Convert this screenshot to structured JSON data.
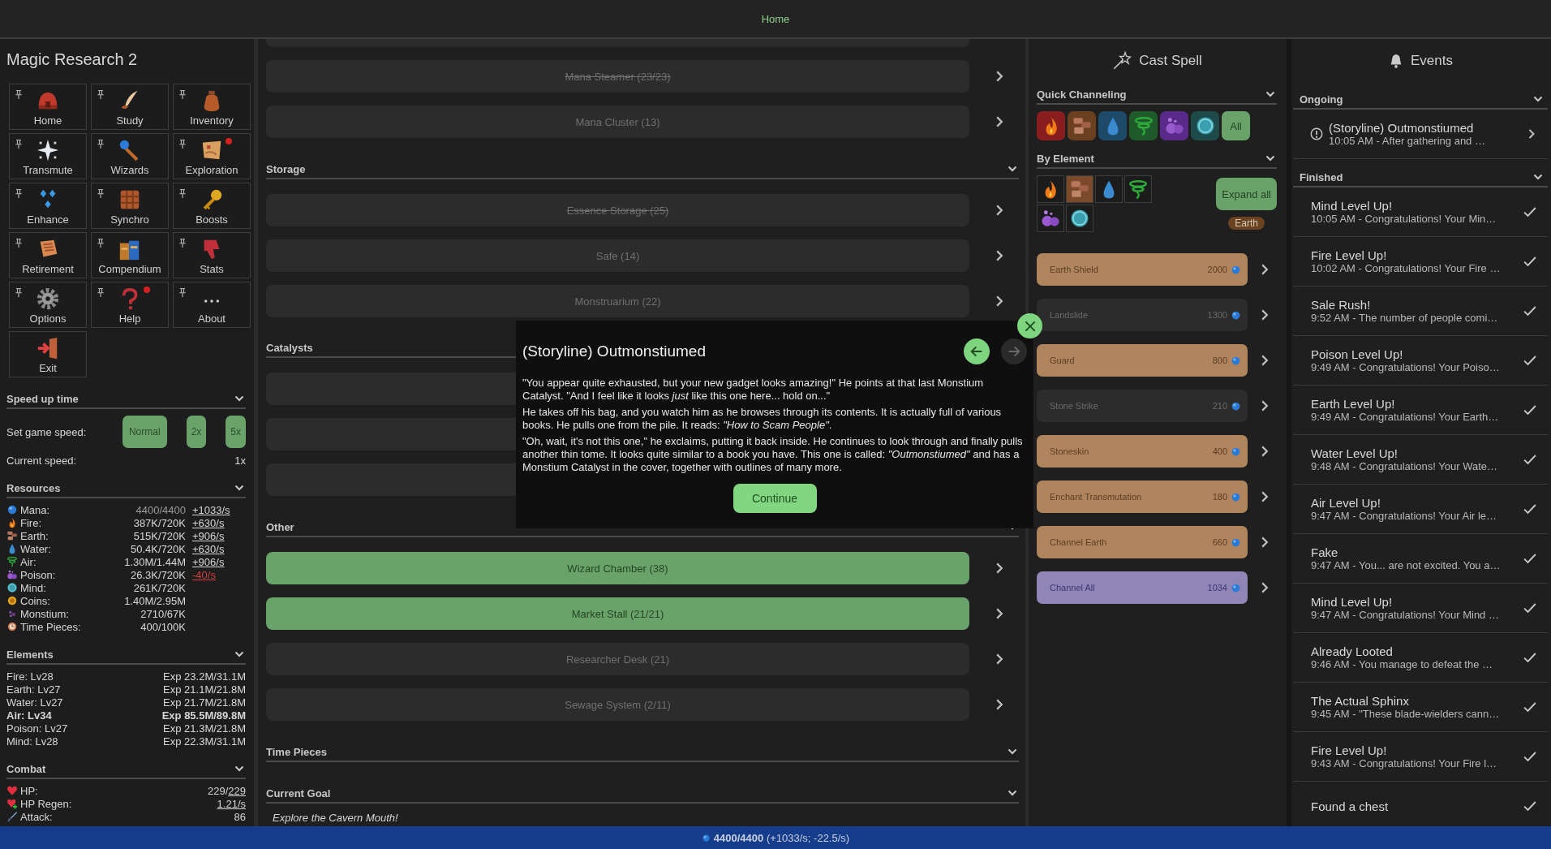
{
  "header": {
    "tab": "Home"
  },
  "sidebar": {
    "title": "Magic Research 2",
    "nav": [
      {
        "label": "Home",
        "kind": "home",
        "pin": true,
        "alert": false
      },
      {
        "label": "Study",
        "kind": "study",
        "pin": true,
        "alert": false
      },
      {
        "label": "Inventory",
        "kind": "inventory",
        "pin": true,
        "alert": false
      },
      {
        "label": "Transmute",
        "kind": "transmute",
        "pin": true,
        "alert": false
      },
      {
        "label": "Wizards",
        "kind": "wizards",
        "pin": true,
        "alert": false
      },
      {
        "label": "Exploration",
        "kind": "exploration",
        "pin": true,
        "alert": true
      },
      {
        "label": "Enhance",
        "kind": "enhance",
        "pin": true,
        "alert": false
      },
      {
        "label": "Synchro",
        "kind": "synchro",
        "pin": true,
        "alert": false
      },
      {
        "label": "Boosts",
        "kind": "boosts",
        "pin": true,
        "alert": false
      },
      {
        "label": "Retirement",
        "kind": "retirement",
        "pin": true,
        "alert": false
      },
      {
        "label": "Compendium",
        "kind": "compendium",
        "pin": true,
        "alert": false
      },
      {
        "label": "Stats",
        "kind": "stats",
        "pin": true,
        "alert": false
      },
      {
        "label": "Options",
        "kind": "options",
        "pin": true,
        "alert": false
      },
      {
        "label": "Help",
        "kind": "help",
        "pin": true,
        "alert": true
      },
      {
        "label": "About",
        "kind": "about",
        "pin": true,
        "alert": false
      },
      {
        "label": "Exit",
        "kind": "exit",
        "pin": false,
        "alert": false
      }
    ],
    "speed": {
      "title": "Speed up time",
      "label": "Set game speed:",
      "options": [
        "Normal",
        "2x",
        "5x"
      ],
      "current_label": "Current speed:",
      "current_value": "1x"
    },
    "resources": {
      "title": "Resources",
      "rows": [
        {
          "kind": "mana",
          "name": "Mana:",
          "value": "4400/4400",
          "capped": true,
          "rate": "+1033/s",
          "negative": false
        },
        {
          "kind": "fire",
          "name": "Fire:",
          "value": "387K/720K",
          "capped": false,
          "rate": "+630/s",
          "negative": false
        },
        {
          "kind": "earth",
          "name": "Earth:",
          "value": "515K/720K",
          "capped": false,
          "rate": "+906/s",
          "negative": false
        },
        {
          "kind": "water",
          "name": "Water:",
          "value": "50.4K/720K",
          "capped": false,
          "rate": "+630/s",
          "negative": false
        },
        {
          "kind": "air",
          "name": "Air:",
          "value": "1.30M/1.44M",
          "capped": false,
          "rate": "+906/s",
          "negative": false
        },
        {
          "kind": "poison",
          "name": "Poison:",
          "value": "26.3K/720K",
          "capped": false,
          "rate": "-40/s",
          "negative": true
        },
        {
          "kind": "mind",
          "name": "Mind:",
          "value": "261K/720K",
          "capped": false
        },
        {
          "kind": "coins",
          "name": "Coins:",
          "value": "1.40M/2.95M",
          "capped": false
        },
        {
          "kind": "monstium",
          "name": "Monstium:",
          "value": "2710/67K",
          "capped": false
        },
        {
          "kind": "timepieces",
          "name": "Time Pieces:",
          "value": "400/100K",
          "capped": false
        }
      ]
    },
    "elements": {
      "title": "Elements",
      "rows": [
        {
          "name": "Fire: Lv28",
          "exp": "Exp 23.2M/31.1M",
          "highlighted": false
        },
        {
          "name": "Earth: Lv27",
          "exp": "Exp 21.1M/21.8M",
          "highlighted": false
        },
        {
          "name": "Water: Lv27",
          "exp": "Exp 21.7M/21.8M",
          "highlighted": false
        },
        {
          "name": "Air: Lv34",
          "exp": "Exp 85.5M/89.8M",
          "highlighted": true
        },
        {
          "name": "Poison: Lv27",
          "exp": "Exp 21.3M/21.8M",
          "highlighted": false
        },
        {
          "name": "Mind: Lv28",
          "exp": "Exp 22.3M/31.1M",
          "highlighted": false
        }
      ]
    },
    "combat": {
      "title": "Combat",
      "rows": [
        {
          "kind": "hp",
          "name": "HP:",
          "value": "229/",
          "link": "229"
        },
        {
          "kind": "regen",
          "name": "HP Regen:",
          "link": "1.21/s"
        },
        {
          "kind": "attack",
          "name": "Attack:",
          "value": "86"
        }
      ]
    }
  },
  "main": {
    "groups": [
      {
        "rows": [
          {
            "affordable": false
          },
          {
            "label": "Mana Steamer (23/23)",
            "maxed": true,
            "affordable": false
          },
          {
            "label": "Mana Cluster (13)",
            "maxed": false,
            "affordable": false
          }
        ]
      },
      {
        "title": "Storage",
        "rows": [
          {
            "label": "Essence Storage (25)",
            "maxed": true,
            "affordable": false
          },
          {
            "label": "Safe (14)",
            "maxed": false,
            "affordable": false
          },
          {
            "label": "Monstruarium (22)",
            "maxed": false,
            "affordable": false
          }
        ]
      },
      {
        "title": "Catalysts",
        "rows": [
          {
            "affordable": false
          },
          {
            "affordable": false
          },
          {
            "affordable": false
          }
        ]
      },
      {
        "title": "Other",
        "rows": [
          {
            "label": "Wizard Chamber (38)",
            "maxed": false,
            "affordable": true
          },
          {
            "label": "Market Stall (21/21)",
            "maxed": false,
            "affordable": true
          },
          {
            "label": "Researcher Desk (21)",
            "maxed": false,
            "affordable": false
          },
          {
            "label": "Sewage System (2/11)",
            "maxed": false,
            "affordable": false
          }
        ]
      },
      {
        "title": "Time Pieces"
      },
      {
        "title": "Current Goal",
        "goal": "Explore the Cavern Mouth!"
      }
    ]
  },
  "spells": {
    "title": "Cast Spell",
    "quick": {
      "title": "Quick Channeling",
      "elements": [
        {
          "kind": "fire"
        },
        {
          "kind": "earth"
        },
        {
          "kind": "water"
        },
        {
          "kind": "air"
        },
        {
          "kind": "poison"
        },
        {
          "kind": "mind"
        }
      ],
      "all": "All"
    },
    "by_element": {
      "title": "By Element",
      "elements": [
        {
          "kind": "fire",
          "selected": false
        },
        {
          "kind": "earth",
          "selected": true
        },
        {
          "kind": "water",
          "selected": false
        },
        {
          "kind": "air",
          "selected": false
        },
        {
          "kind": "poison",
          "selected": false
        },
        {
          "kind": "mind",
          "selected": false
        }
      ],
      "expand": "Expand all",
      "tag": "Earth"
    },
    "list": [
      {
        "name": "Earth Shield",
        "cost": "2000",
        "kind": "earth",
        "affordable": true
      },
      {
        "name": "Landslide",
        "cost": "1300",
        "kind": "earth",
        "affordable": false
      },
      {
        "name": "Guard",
        "cost": "800",
        "kind": "earth",
        "affordable": true
      },
      {
        "name": "Stone Strike",
        "cost": "210",
        "kind": "earth",
        "affordable": false
      },
      {
        "name": "Stoneskin",
        "cost": "400",
        "kind": "earth",
        "affordable": true
      },
      {
        "name": "Enchant Transmutation",
        "cost": "180",
        "kind": "earth",
        "affordable": true
      },
      {
        "name": "Channel Earth",
        "cost": "660",
        "kind": "earth",
        "affordable": true
      },
      {
        "name": "Channel All",
        "cost": "1034",
        "kind": "all",
        "affordable": true
      }
    ]
  },
  "events": {
    "title": "Events",
    "ongoing": {
      "title": "Ongoing",
      "items": [
        {
          "title": "(Storyline) Outmonstiumed",
          "text": "10:05 AM - After gathering and …"
        }
      ]
    },
    "finished": {
      "title": "Finished",
      "items": [
        {
          "title": "Mind Level Up!",
          "text": "10:05 AM - Congratulations! Your Min…"
        },
        {
          "title": "Fire Level Up!",
          "text": "10:02 AM - Congratulations! Your Fire …"
        },
        {
          "title": "Sale Rush!",
          "text": "9:52 AM - The number of people comi…"
        },
        {
          "title": "Poison Level Up!",
          "text": "9:49 AM - Congratulations! Your Poiso…"
        },
        {
          "title": "Earth Level Up!",
          "text": "9:49 AM - Congratulations! Your Earth…"
        },
        {
          "title": "Water Level Up!",
          "text": "9:48 AM - Congratulations! Your Wate…"
        },
        {
          "title": "Air Level Up!",
          "text": "9:47 AM - Congratulations! Your Air le…"
        },
        {
          "title": "Fake",
          "text": "9:47 AM - You... are not excited. You a…"
        },
        {
          "title": "Mind Level Up!",
          "text": "9:47 AM - Congratulations! Your Mind …"
        },
        {
          "title": "Already Looted",
          "text": "9:46 AM - You manage to defeat the …"
        },
        {
          "title": "The Actual Sphinx",
          "text": "9:45 AM - \"These blade-wielders cann…"
        },
        {
          "title": "Fire Level Up!",
          "text": "9:43 AM - Congratulations! Your Fire l…"
        },
        {
          "title": "Found a chest"
        }
      ]
    }
  },
  "dialog": {
    "title": "(Storyline) Outmonstiumed",
    "paragraphs": [
      "\"You appear quite exhausted, but your new gadget looks amazing!\" He points at that last Monstium Catalyst. \"And I feel like it looks *just* like this one here... hold on...\"",
      "He takes off his bag, and you watch him as he browses through its contents. It is actually full of various books. He pulls one from the pile. It reads: *\"How to Scam People\"*.",
      "\"Oh, wait, it's not this one,\" he exclaims, putting it back inside. He continues to look through and finally pulls another thin tome. It looks quite similar to a book you have. This one is called: *\"Outmonstiumed\"* and has a Monstium Catalyst in the cover, together with outlines of many more."
    ],
    "back_enabled": true,
    "forward_enabled": false,
    "continue": "Continue"
  },
  "status": {
    "text": "**4400/4400** (+1033/s; -22.5/s)"
  }
}
